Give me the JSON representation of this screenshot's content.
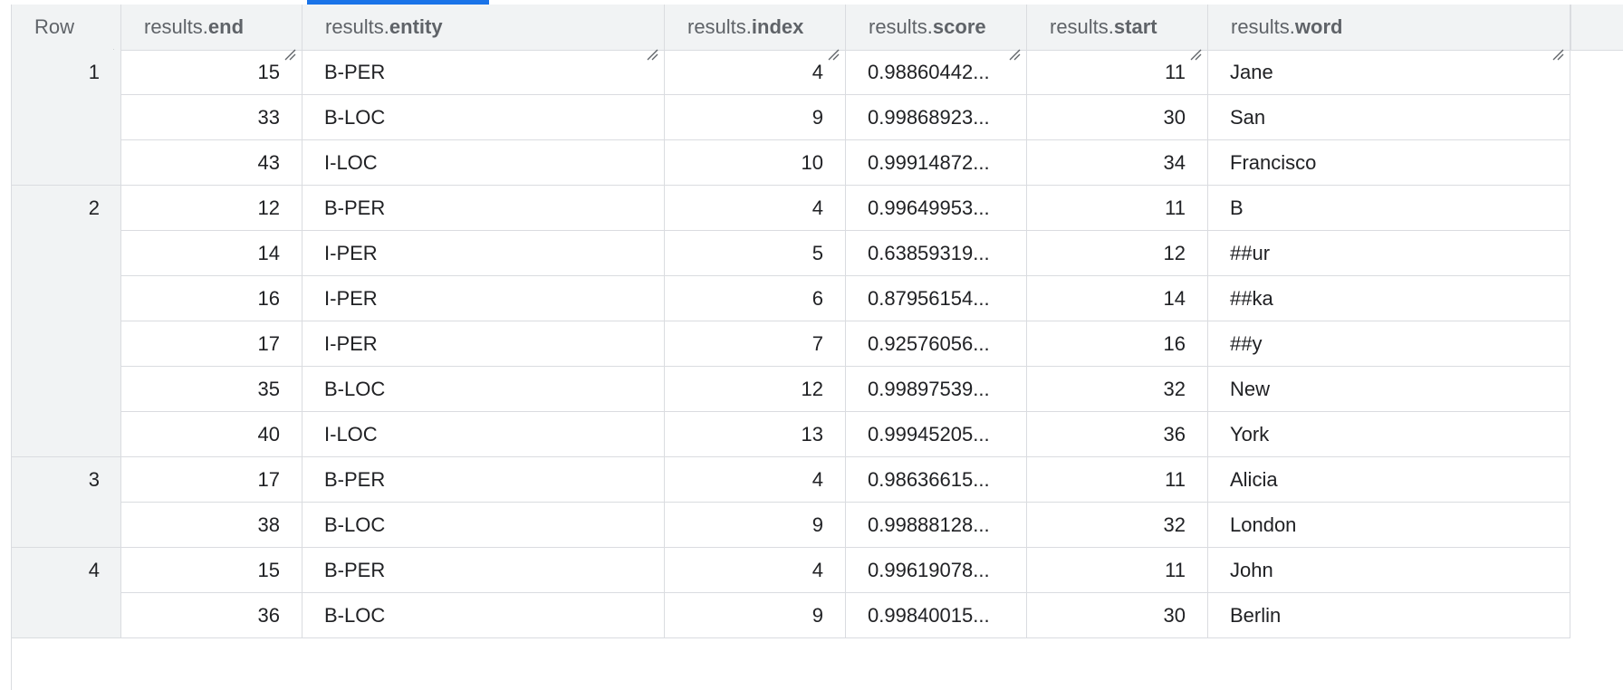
{
  "table": {
    "headers": [
      {
        "prefix": "",
        "field": "Row"
      },
      {
        "prefix": "results.",
        "field": "end"
      },
      {
        "prefix": "results.",
        "field": "entity"
      },
      {
        "prefix": "results.",
        "field": "index"
      },
      {
        "prefix": "results.",
        "field": "score"
      },
      {
        "prefix": "results.",
        "field": "start"
      },
      {
        "prefix": "results.",
        "field": "word"
      }
    ],
    "rows": [
      {
        "row": "1",
        "results": [
          {
            "end": "15",
            "entity": "B-PER",
            "index": "4",
            "score": "0.98860442...",
            "start": "11",
            "word": "Jane"
          },
          {
            "end": "33",
            "entity": "B-LOC",
            "index": "9",
            "score": "0.99868923...",
            "start": "30",
            "word": "San"
          },
          {
            "end": "43",
            "entity": "I-LOC",
            "index": "10",
            "score": "0.99914872...",
            "start": "34",
            "word": "Francisco"
          }
        ]
      },
      {
        "row": "2",
        "results": [
          {
            "end": "12",
            "entity": "B-PER",
            "index": "4",
            "score": "0.99649953...",
            "start": "11",
            "word": "B"
          },
          {
            "end": "14",
            "entity": "I-PER",
            "index": "5",
            "score": "0.63859319...",
            "start": "12",
            "word": "##ur"
          },
          {
            "end": "16",
            "entity": "I-PER",
            "index": "6",
            "score": "0.87956154...",
            "start": "14",
            "word": "##ka"
          },
          {
            "end": "17",
            "entity": "I-PER",
            "index": "7",
            "score": "0.92576056...",
            "start": "16",
            "word": "##y"
          },
          {
            "end": "35",
            "entity": "B-LOC",
            "index": "12",
            "score": "0.99897539...",
            "start": "32",
            "word": "New"
          },
          {
            "end": "40",
            "entity": "I-LOC",
            "index": "13",
            "score": "0.99945205...",
            "start": "36",
            "word": "York"
          }
        ]
      },
      {
        "row": "3",
        "results": [
          {
            "end": "17",
            "entity": "B-PER",
            "index": "4",
            "score": "0.98636615...",
            "start": "11",
            "word": "Alicia"
          },
          {
            "end": "38",
            "entity": "B-LOC",
            "index": "9",
            "score": "0.99888128...",
            "start": "32",
            "word": "London"
          }
        ]
      },
      {
        "row": "4",
        "results": [
          {
            "end": "15",
            "entity": "B-PER",
            "index": "4",
            "score": "0.99619078...",
            "start": "11",
            "word": "John"
          },
          {
            "end": "36",
            "entity": "B-LOC",
            "index": "9",
            "score": "0.99840015...",
            "start": "30",
            "word": "Berlin"
          }
        ]
      }
    ]
  }
}
